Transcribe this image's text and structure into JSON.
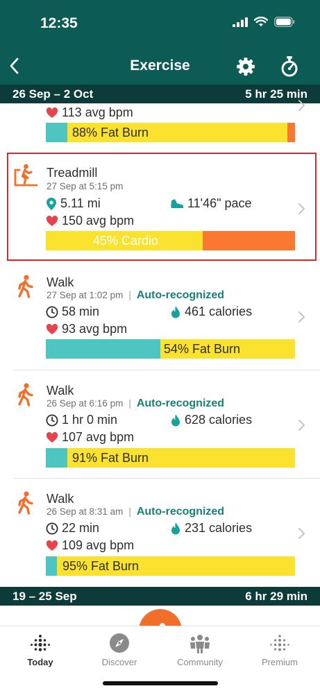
{
  "status": {
    "time": "12:35"
  },
  "nav": {
    "title": "Exercise"
  },
  "weeks": [
    {
      "range": "26 Sep – 2 Oct",
      "total": "5 hr 25 min"
    },
    {
      "range": "19 – 25 Sep",
      "total": "6 hr 29 min"
    }
  ],
  "entries": [
    {
      "bpm": "113",
      "bpm_unit": "avg bpm",
      "zone_label": "88% Fat Burn",
      "zone": {
        "peak_pct": 0,
        "light_pct": 8.5,
        "fatburn_pct": 88.5,
        "cardio_pct": 3
      }
    },
    {
      "name": "Treadmill",
      "date": "27 Sep at 5:15 pm",
      "distance": "5.11 mi",
      "pace": "11'46\" pace",
      "bpm": "150",
      "bpm_unit": "avg bpm",
      "zone_label": "45% Cardio",
      "zone": {
        "fatburn_pct": 63,
        "cardio_pct": 37
      }
    },
    {
      "name": "Walk",
      "date": "27 Sep at 1:02 pm",
      "tag": "Auto-recognized",
      "duration": "58 min",
      "calories": "461",
      "calories_unit": "calories",
      "bpm": "93",
      "bpm_unit": "avg bpm",
      "zone_label": "54% Fat Burn",
      "zone": {
        "light_pct": 46,
        "fatburn_pct": 54
      }
    },
    {
      "name": "Walk",
      "date": "26 Sep at 6:16 pm",
      "tag": "Auto-recognized",
      "duration": "1 hr 0 min",
      "calories": "628",
      "calories_unit": "calories",
      "bpm": "107",
      "bpm_unit": "avg bpm",
      "zone_label": "91% Fat Burn",
      "zone": {
        "light_pct": 8.5,
        "fatburn_pct": 91.5
      }
    },
    {
      "name": "Walk",
      "date": "26 Sep at 8:31 am",
      "tag": "Auto-recognized",
      "duration": "22 min",
      "calories": "231",
      "calories_unit": "calories",
      "bpm": "109",
      "bpm_unit": "avg bpm",
      "zone_label": "95% Fat Burn",
      "zone": {
        "light_pct": 4.5,
        "fatburn_pct": 95.5
      }
    }
  ],
  "tabs": [
    {
      "label": "Today",
      "icon": "dots-grid-icon",
      "active": true
    },
    {
      "label": "Discover",
      "icon": "compass-icon",
      "active": false
    },
    {
      "label": "Community",
      "icon": "community-icon",
      "active": false
    },
    {
      "label": "Premium",
      "icon": "premium-dots-icon",
      "active": false
    }
  ],
  "colors": {
    "header_teal": "#0c5b55",
    "week_header": "#0c3b3a",
    "accent_orange": "#f26f2b",
    "zone_light": "#4ec5c1",
    "zone_fatburn": "#fbe22f",
    "zone_cardio": "#fb7830",
    "auto_tag": "#16807a",
    "heart": "#e8424d",
    "highlight_border": "#e0242c"
  }
}
